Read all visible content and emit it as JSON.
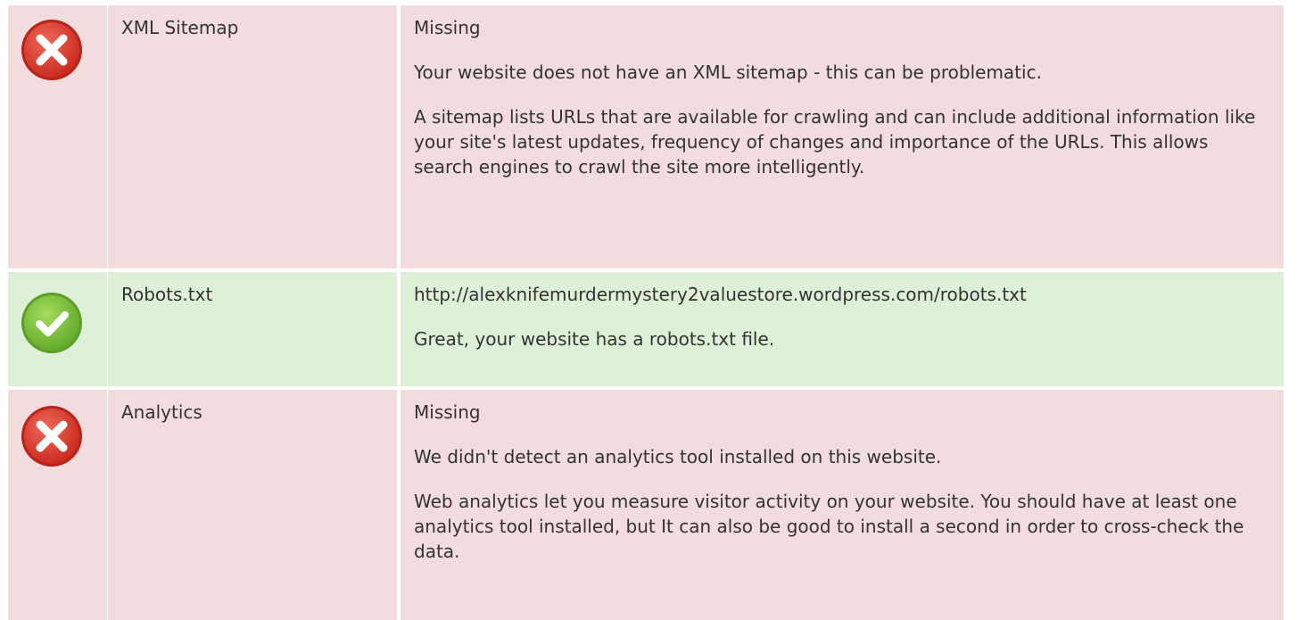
{
  "colors": {
    "fail_bg": "#f2dcdd",
    "pass_bg": "#dff0d8",
    "fail_icon": "#d93b2c",
    "pass_icon": "#7cc13a",
    "text": "#333333"
  },
  "rows": [
    {
      "status": "fail",
      "icon": "error-x-icon",
      "name": "XML Sitemap",
      "value": "Missing",
      "summary": "Your website does not have an XML sitemap - this can be problematic.",
      "detail": "A sitemap lists URLs that are available for crawling and can include additional information like your site's latest updates, frequency of changes and importance of the URLs. This allows search engines to crawl the site more intelligently."
    },
    {
      "status": "pass",
      "icon": "check-icon",
      "name": "Robots.txt",
      "value": "http://alexknifemurdermystery2valuestore.wordpress.com/robots.txt",
      "summary": "Great, your website has a robots.txt file."
    },
    {
      "status": "fail",
      "icon": "error-x-icon",
      "name": "Analytics",
      "value": "Missing",
      "summary": "We didn't detect an analytics tool installed on this website.",
      "detail": "Web analytics let you measure visitor activity on your website. You should have at least one analytics tool installed, but It can also be good to install a second in order to cross-check the data."
    }
  ]
}
